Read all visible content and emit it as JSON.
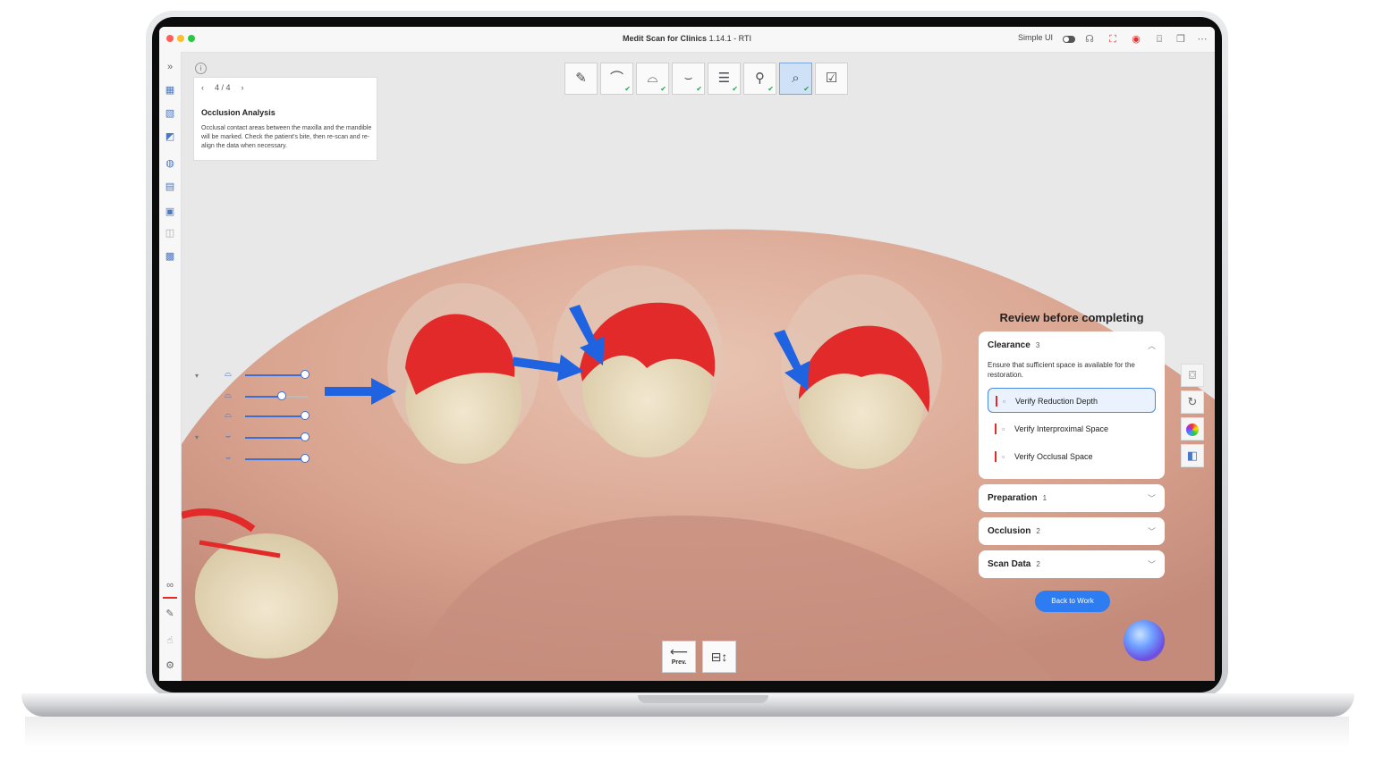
{
  "window": {
    "app_name": "Medit Scan for Clinics",
    "version": "1.14.1 - RTI",
    "simple_ui_label": "Simple UI"
  },
  "info_card": {
    "pager": "4 / 4",
    "title": "Occlusion Analysis",
    "description": "Occlusal contact areas between the maxilla and the mandible will be marked. Check the patient's bite, then re-scan and re-align the data when necessary."
  },
  "review": {
    "title": "Review before completing",
    "sections": [
      {
        "label": "Clearance",
        "count": "3",
        "expanded": true,
        "description": "Ensure that sufficient space is available for the restoration.",
        "items": [
          {
            "label": "Verify Reduction Depth",
            "selected": true
          },
          {
            "label": "Verify Interproximal Space",
            "selected": false
          },
          {
            "label": "Verify Occlusal Space",
            "selected": false
          }
        ]
      },
      {
        "label": "Preparation",
        "count": "1",
        "expanded": false
      },
      {
        "label": "Occlusion",
        "count": "2",
        "expanded": false
      },
      {
        "label": "Scan Data",
        "count": "2",
        "expanded": false
      }
    ],
    "back_button": "Back to Work"
  },
  "bottom": {
    "prev_label": "Prev."
  },
  "colors": {
    "accent": "#2d7cf2",
    "contact_red": "#e32a2a",
    "arrow_blue": "#1f63e0"
  }
}
